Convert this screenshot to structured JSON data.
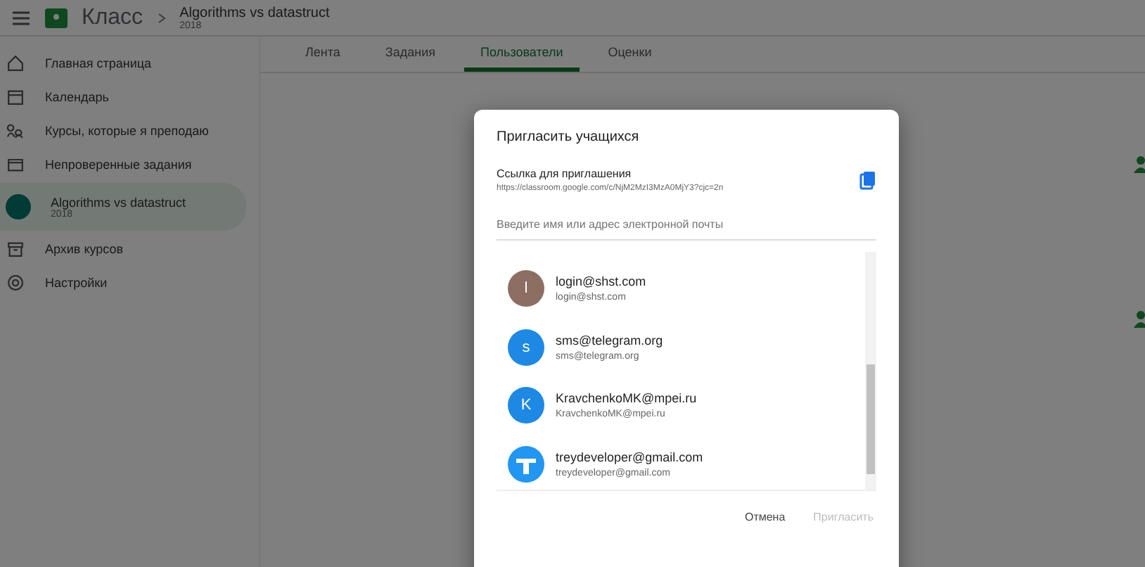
{
  "header": {
    "app_name": "Класс",
    "course_title": "Algorithms vs datastruct",
    "course_subtitle": "2018"
  },
  "sidebar": {
    "items": [
      {
        "kind": "home",
        "label": "Главная страница",
        "selected": false
      },
      {
        "kind": "calendar",
        "label": "Календарь",
        "selected": false
      },
      {
        "kind": "teach",
        "label": "Курсы, которые я преподаю",
        "selected": false
      },
      {
        "kind": "review",
        "label": "Непроверенные задания",
        "selected": false
      },
      {
        "kind": "course",
        "label": "Algorithms vs datastruct",
        "sublabel": "2018",
        "selected": true
      },
      {
        "kind": "archive",
        "label": "Архив курсов",
        "selected": false
      },
      {
        "kind": "settings",
        "label": "Настройки",
        "selected": false
      }
    ]
  },
  "tabs": [
    {
      "label": "Лента",
      "selected": false
    },
    {
      "label": "Задания",
      "selected": false
    },
    {
      "label": "Пользователи",
      "selected": true
    },
    {
      "label": "Оценки",
      "selected": false
    }
  ],
  "dialog": {
    "title": "Пригласить учащихся",
    "link_label": "Ссылка для приглашения",
    "link_url": "https://classroom.google.com/c/NjM2MzI3MzA0MjY3?cjc=2n",
    "search": {
      "placeholder": "Введите имя или адрес электронной почты"
    },
    "contacts": [
      {
        "kind": "letter",
        "initial": "l",
        "color": "#8d6e63",
        "name": "login@shst.com",
        "email": "login@shst.com"
      },
      {
        "kind": "letter",
        "initial": "s",
        "color": "#1e88e5",
        "name": "sms@telegram.org",
        "email": "sms@telegram.org"
      },
      {
        "kind": "letter",
        "initial": "K",
        "color": "#1e88e5",
        "name": "KravchenkoMK@mpei.ru",
        "email": "KravchenkoMK@mpei.ru"
      },
      {
        "kind": "logo",
        "color": "#2196f3",
        "name": "treydeveloper@gmail.com",
        "email": "treydeveloper@gmail.com"
      }
    ],
    "buttons": [
      {
        "label": "Отмена",
        "disabled": false
      },
      {
        "label": "Пригласить",
        "disabled": true
      }
    ]
  }
}
